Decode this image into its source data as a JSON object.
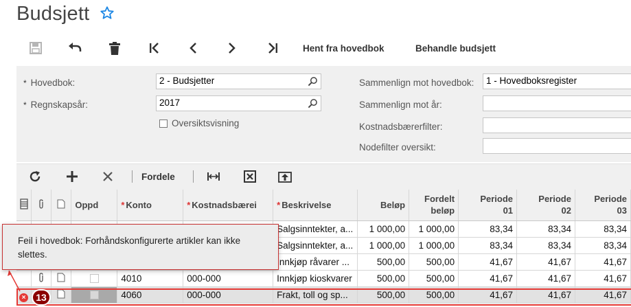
{
  "header": {
    "title": "Budsjett",
    "favorite_icon": "star-outline-icon"
  },
  "toolbar": {
    "icons": [
      "save-icon",
      "undo-icon",
      "delete-icon",
      "first-record-icon",
      "previous-record-icon",
      "next-record-icon",
      "last-record-icon"
    ],
    "fetch_label": "Hent fra hovedbok",
    "manage_label": "Behandle budsjett"
  },
  "form": {
    "ledger_label": "Hovedbok:",
    "ledger_value": "2 - Budsjetter",
    "year_label": "Regnskapsår:",
    "year_value": "2017",
    "tree_view_label": "Oversiktsvisning",
    "compare_ledger_label": "Sammenlign mot hovedbok:",
    "compare_ledger_value": "1 - Hovedboksregister",
    "compare_year_label": "Sammenlign mot år:",
    "compare_year_value": "",
    "cost_filter_label": "Kostnadsbærerfilter:",
    "cost_filter_value": "",
    "node_filter_label": "Nodefilter oversikt:",
    "node_filter_value": ""
  },
  "grid_toolbar": {
    "distribute_label": "Fordele"
  },
  "grid": {
    "columns": {
      "oppd": "Oppd",
      "konto": "Konto",
      "cost": "Kostnadsbærei",
      "desc": "Beskrivelse",
      "amount": "Beløp",
      "dist1": "Fordelt",
      "dist2": "beløp",
      "p1a": "Periode",
      "p1b": "01",
      "p2a": "Periode",
      "p2b": "02",
      "p3a": "Periode",
      "p3b": "03"
    },
    "rows": [
      {
        "konto": "",
        "cost": "",
        "desc": "Salgsinntekter, a...",
        "amount": "1 000,00",
        "dist": "1 000,00",
        "p1": "83,34",
        "p2": "83,34",
        "p3": "83,34"
      },
      {
        "konto": "",
        "cost": "",
        "desc": "Salgsinntekter, a...",
        "amount": "1 000,00",
        "dist": "1 000,00",
        "p1": "83,34",
        "p2": "83,34",
        "p3": "83,34"
      },
      {
        "konto": "",
        "cost": "",
        "desc": "Innkjøp råvarer ...",
        "amount": "500,00",
        "dist": "500,00",
        "p1": "41,67",
        "p2": "41,67",
        "p3": "41,67"
      },
      {
        "konto": "4010",
        "cost": "000-000",
        "desc": "Innkjøp kioskvarer",
        "amount": "500,00",
        "dist": "500,00",
        "p1": "41,67",
        "p2": "41,67",
        "p3": "41,67"
      },
      {
        "konto": "4060",
        "cost": "000-000",
        "desc": "Frakt, toll og sp...",
        "amount": "500,00",
        "dist": "500,00",
        "p1": "41,67",
        "p2": "41,67",
        "p3": "41,67"
      }
    ]
  },
  "error": {
    "count": "13",
    "message": "Feil i hovedbok: Forhåndskonfigurerte artikler kan ikke slettes."
  },
  "colors": {
    "error": "#e53935",
    "badge": "#8b0000",
    "accent": "#1e88e5"
  }
}
